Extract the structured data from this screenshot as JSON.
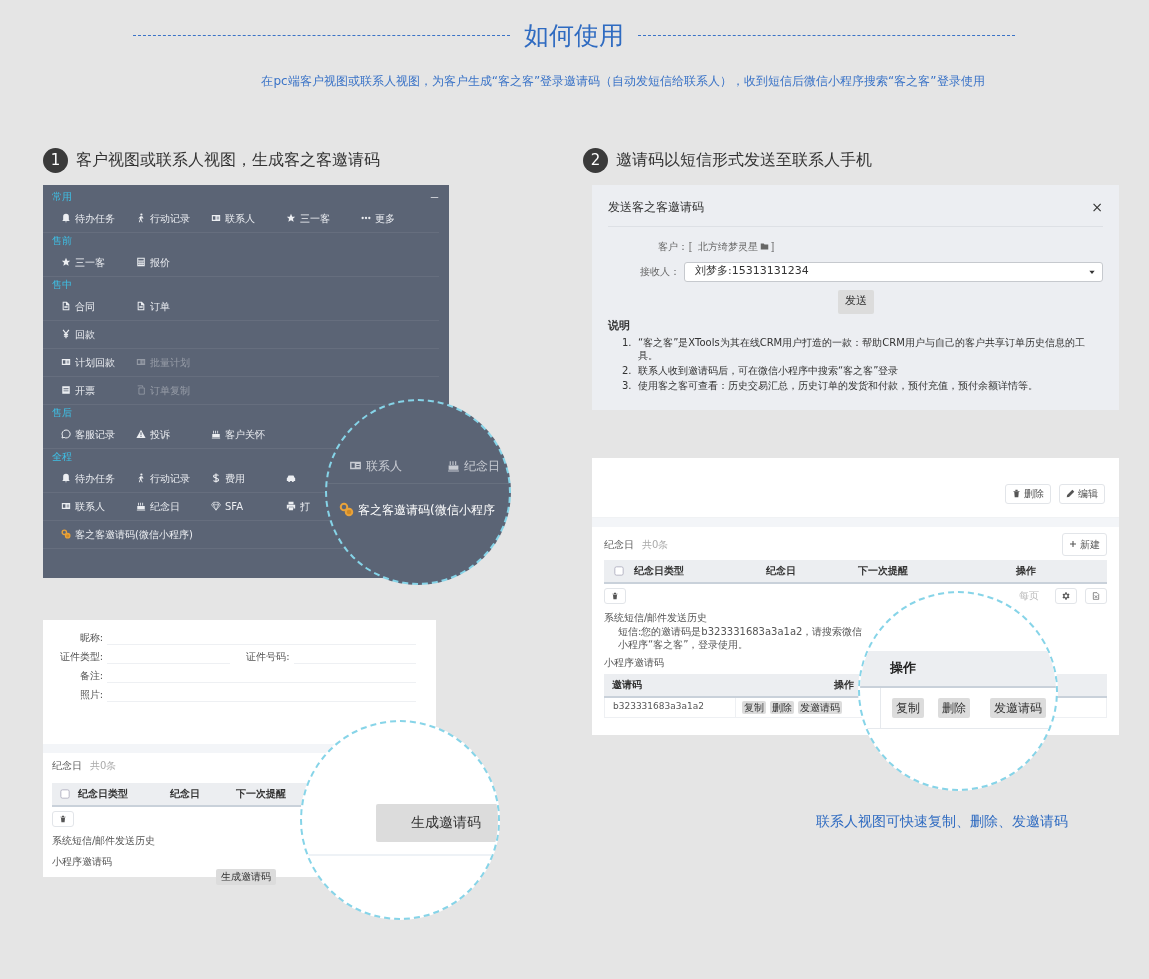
{
  "header": {
    "title": "如何使用",
    "subtitle": "在pc端客户视图或联系人视图，为客户生成“客之客”登录邀请码（自动发短信给联系人），收到短信后微信小程序搜索“客之客”登录使用"
  },
  "steps": [
    {
      "number": "1",
      "title": "客户视图或联系人视图，生成客之客邀请码"
    },
    {
      "number": "2",
      "title": "邀请码以短信形式发送至联系人手机"
    }
  ],
  "menu_panel": {
    "sections": [
      {
        "label": "常用",
        "rows": [
          [
            {
              "label": "待办任务",
              "disabled": false
            },
            {
              "label": "行动记录",
              "disabled": false
            },
            {
              "label": "联系人",
              "disabled": false
            },
            {
              "label": "三一客",
              "disabled": false
            },
            {
              "label": "更多",
              "disabled": false
            }
          ]
        ]
      },
      {
        "label": "售前",
        "rows": [
          [
            {
              "label": "三一客",
              "disabled": false
            },
            {
              "label": "报价",
              "disabled": false
            }
          ]
        ]
      },
      {
        "label": "售中",
        "rows": [
          [
            {
              "label": "合同",
              "disabled": false
            },
            {
              "label": "订单",
              "disabled": false
            }
          ],
          [
            {
              "label": "回款",
              "disabled": false
            }
          ],
          [
            {
              "label": "计划回款",
              "disabled": false
            },
            {
              "label": "批量计划",
              "disabled": true
            }
          ],
          [
            {
              "label": "开票",
              "disabled": false
            },
            {
              "label": "订单复制",
              "disabled": true
            }
          ]
        ]
      },
      {
        "label": "售后",
        "rows": [
          [
            {
              "label": "客服记录",
              "disabled": false
            },
            {
              "label": "投诉",
              "disabled": false
            },
            {
              "label": "客户关怀",
              "disabled": false
            }
          ]
        ]
      },
      {
        "label": "全程",
        "rows": [
          [
            {
              "label": "待办任务",
              "disabled": false
            },
            {
              "label": "行动记录",
              "disabled": false
            },
            {
              "label": "费用",
              "disabled": false
            },
            {
              "disabled": false
            }
          ],
          [
            {
              "label": "联系人",
              "disabled": false
            },
            {
              "label": "纪念日",
              "disabled": false
            },
            {
              "label": "SFA",
              "disabled": false
            },
            {
              "label": "打",
              "disabled": false
            }
          ],
          [
            {
              "label": "客之客邀请码(微信小程序)",
              "disabled": false
            }
          ]
        ]
      }
    ],
    "lens": {
      "items": [
        {
          "label": "联系人"
        },
        {
          "label": "纪念日"
        }
      ],
      "highlight": "客之客邀请码(微信小程序"
    }
  },
  "contact_form": {
    "field_rows": [
      [
        "昵称:"
      ],
      [
        "证件类型:",
        "证件号码:"
      ],
      [
        "备注:"
      ],
      [
        "照片:"
      ]
    ],
    "section_title": "纪念日",
    "count": "共0条",
    "columns": [
      "纪念日类型",
      "纪念日",
      "下一次提醒"
    ],
    "history_label": "系统短信/邮件发送历史",
    "invite_label": "小程序邀请码",
    "generate_button": "生成邀请码",
    "lens_button": "生成邀请码"
  },
  "modal": {
    "title": "发送客之客邀请码",
    "close": "×",
    "customer_label": "客户：",
    "customer_open": "〚",
    "customer_value": "北方绮梦灵星",
    "customer_close": "〛",
    "recipient_label": "接收人：",
    "recipient_value": "刘梦多:15313131234",
    "send_button": "发送",
    "notes_title": "说明",
    "notes": [
      {
        "number": "1.",
        "text": "“客之客”是XTools为其在线CRM用户打造的一款：帮助CRM用户与自己的客户共享订单历史信息的工具。"
      },
      {
        "number": "2.",
        "text": "联系人收到邀请码后，可在微信小程序中搜索“客之客”登录"
      },
      {
        "number": "3.",
        "text": "使用客之客可查看：历史交易汇总，历史订单的发货和付款，预付充值，预付余额详情等。"
      }
    ]
  },
  "contact_detail": {
    "buttons": [
      "删除",
      "编辑"
    ],
    "section_title": "纪念日",
    "count": "共0条",
    "new_button": "新建",
    "columns": [
      "纪念日类型",
      "纪念日",
      "下一次提醒",
      "操作"
    ],
    "page_size_label": "每页",
    "history_label": "系统短信/邮件发送历史",
    "history_text": "短信:您的邀请码是b323331683a3a1a2，请搜索微信小程序“客之客”，登录使用。",
    "invite_label": "小程序邀请码",
    "invite_columns": [
      "邀请码",
      "操作"
    ],
    "invite_rows": [
      {
        "code": "b323331683a3a1a2",
        "actions": [
          "复制",
          "删除",
          "发邀请码"
        ]
      }
    ],
    "lens": {
      "header": "操作",
      "actions": [
        "复制",
        "删除",
        "发邀请码"
      ]
    }
  },
  "caption": "联系人视图可快速复制、删除、发邀请码"
}
